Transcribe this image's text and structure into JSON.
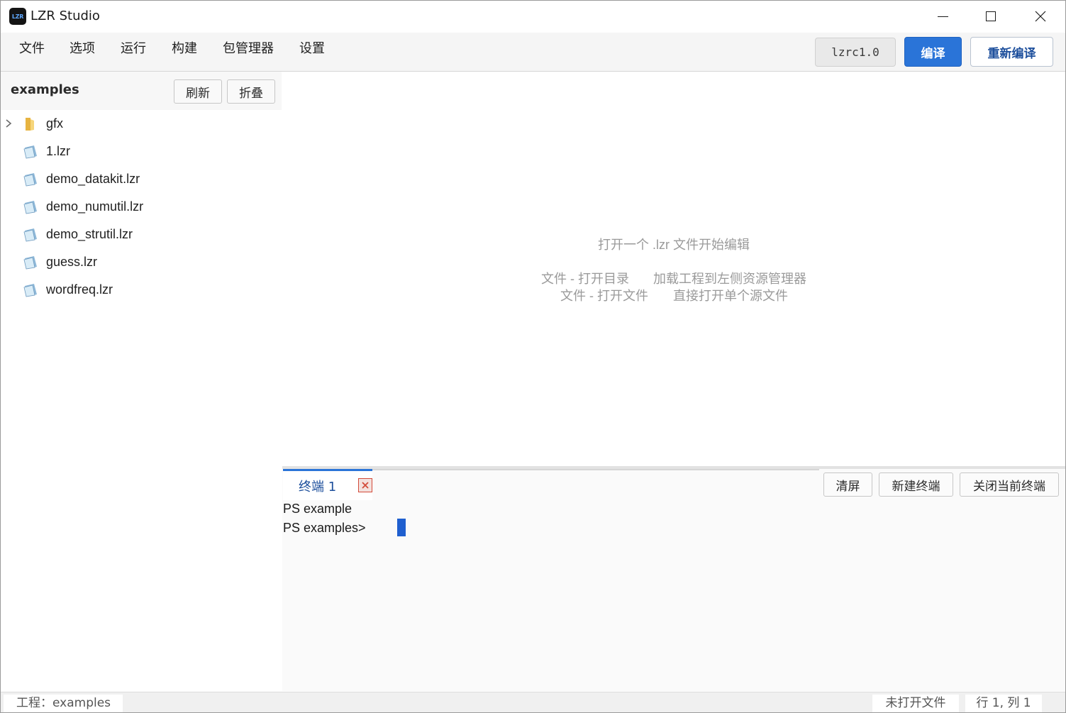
{
  "window": {
    "title": "LZR Studio",
    "logo_text": "LZR"
  },
  "menu": {
    "items": [
      "文件",
      "选项",
      "运行",
      "构建",
      "包管理器",
      "设置"
    ]
  },
  "toolbar": {
    "version": "lzrc1.0",
    "compile_label": "编译",
    "recompile_label": "重新编译",
    "accent_color": "#2a74d8"
  },
  "explorer": {
    "project_name": "examples",
    "refresh_label": "刷新",
    "collapse_label": "折叠",
    "items": [
      {
        "label": "gfx",
        "kind": "folder",
        "icon": "folder-icon"
      },
      {
        "label": "1.lzr",
        "kind": "file",
        "icon": "file-icon"
      },
      {
        "label": "demo_datakit.lzr",
        "kind": "file",
        "icon": "file-icon"
      },
      {
        "label": "demo_numutil.lzr",
        "kind": "file",
        "icon": "file-icon"
      },
      {
        "label": "demo_strutil.lzr",
        "kind": "file",
        "icon": "file-icon"
      },
      {
        "label": "guess.lzr",
        "kind": "file",
        "icon": "file-icon"
      },
      {
        "label": "wordfreq.lzr",
        "kind": "file",
        "icon": "file-icon"
      }
    ]
  },
  "editor": {
    "hint_title": "打开一个 .lzr 文件开始编辑",
    "hints": [
      {
        "action": "文件 - 打开目录",
        "description": "加载工程到左侧资源管理器"
      },
      {
        "action": "文件 - 打开文件",
        "description": "直接打开单个源文件"
      }
    ]
  },
  "terminal": {
    "tab_label": "终端 1",
    "clear_label": "清屏",
    "new_label": "新建终端",
    "close_label": "关闭当前终端",
    "lines": [
      "PS example",
      "PS examples>"
    ]
  },
  "status": {
    "project": "工程：examples",
    "file": "未打开文件",
    "position": "行 1, 列 1"
  }
}
